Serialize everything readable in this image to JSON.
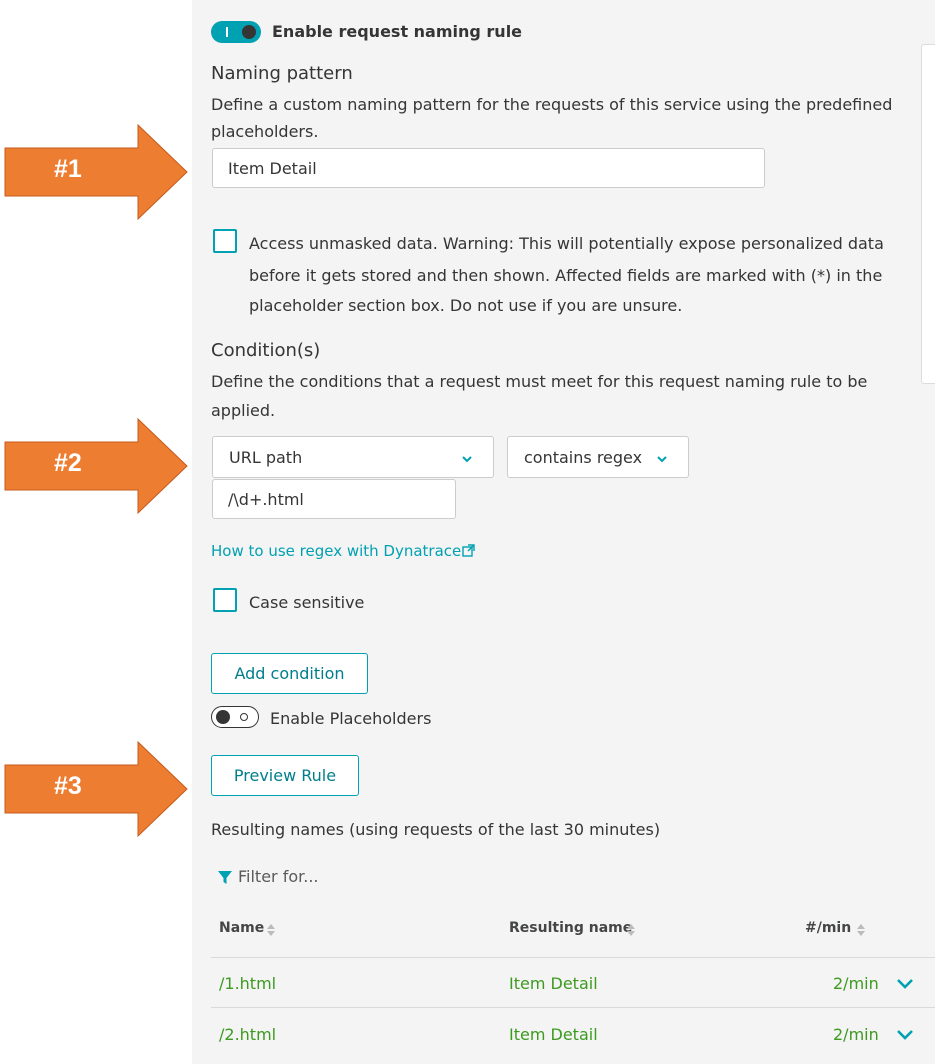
{
  "colors": {
    "accent": "#00a1b2",
    "arrow": "#ed7d31",
    "link_green": "#3c9a1f",
    "panel_bg": "#f4f4f4"
  },
  "callouts": [
    "#1",
    "#2",
    "#3"
  ],
  "rule": {
    "toggle_label": "Enable request naming rule",
    "toggle_on": true
  },
  "naming": {
    "heading": "Naming pattern",
    "description_line1": "Define a custom naming pattern for the requests of this service using the predefined",
    "description_line2": "placeholders.",
    "value": "Item Detail"
  },
  "unmasked": {
    "checked": false,
    "line1": "Access unmasked data. Warning: This will potentially expose personalized data",
    "line2": "before it gets stored and then shown. Affected fields are marked with (*) in the",
    "line3": "placeholder section box. Do not use if you are unsure."
  },
  "conditions": {
    "heading": "Condition(s)",
    "description_line1": "Define the conditions that a request must meet for this request naming rule to be",
    "description_line2": "applied.",
    "attribute": "URL path",
    "operator": "contains regex",
    "value": "/\\d+.html",
    "regex_link": "How to use regex with Dynatrace",
    "case_sensitive_label": "Case sensitive",
    "case_sensitive_checked": false,
    "add_button": "Add condition"
  },
  "placeholders": {
    "label": "Enable Placeholders",
    "enabled": false
  },
  "preview": {
    "button": "Preview Rule",
    "result_heading": "Resulting names (using requests of the last 30 minutes)",
    "filter_placeholder": "Filter for...",
    "columns": [
      "Name",
      "Resulting name",
      "#/min"
    ],
    "rows": [
      {
        "name": "/1.html",
        "resulting": "Item Detail",
        "rate": "2/min"
      },
      {
        "name": "/2.html",
        "resulting": "Item Detail",
        "rate": "2/min"
      }
    ]
  }
}
